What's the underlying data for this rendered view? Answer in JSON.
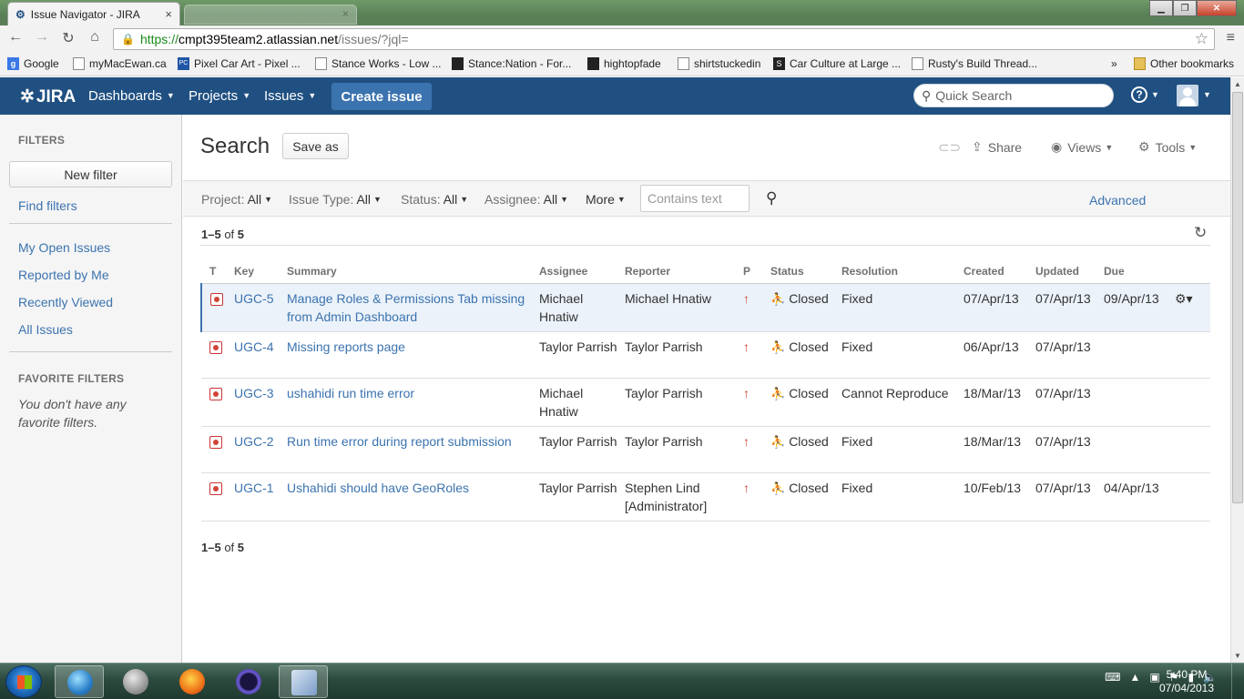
{
  "browser": {
    "tab_active_title": "Issue Navigator - JIRA",
    "tab_close": "×",
    "url_scheme": "https://",
    "url_host": "cmpt395team2.atlassian.net",
    "url_path": "/issues/?jql=",
    "bookmarks": [
      "Google",
      "myMacEwan.ca",
      "Pixel Car Art - Pixel ...",
      "Stance Works - Low ...",
      "Stance:Nation - For...",
      "hightopfade",
      "shirtstuckedin",
      "Car Culture at Large ...",
      "Rusty's Build Thread..."
    ],
    "bookmarks_overflow": "»",
    "other_bookmarks": "Other bookmarks"
  },
  "header": {
    "logo": "JIRA",
    "nav": [
      "Dashboards",
      "Projects",
      "Issues"
    ],
    "create_issue": "Create issue",
    "quick_search_placeholder": "Quick Search",
    "help": "?"
  },
  "sidebar": {
    "filters_heading": "FILTERS",
    "new_filter": "New filter",
    "find_filters": "Find filters",
    "links": [
      "My Open Issues",
      "Reported by Me",
      "Recently Viewed",
      "All Issues"
    ],
    "favorite_heading": "FAVORITE FILTERS",
    "no_favorites": "You don't have any favorite filters."
  },
  "main": {
    "title": "Search",
    "save_as": "Save as",
    "share": "Share",
    "views": "Views",
    "tools": "Tools",
    "criteria": [
      {
        "label": "Project:",
        "value": "All"
      },
      {
        "label": "Issue Type:",
        "value": "All"
      },
      {
        "label": "Status:",
        "value": "All"
      },
      {
        "label": "Assignee:",
        "value": "All"
      }
    ],
    "more": "More",
    "contains_text_placeholder": "Contains text",
    "advanced": "Advanced",
    "count_range": "1–5",
    "count_of": "of",
    "count_total": "5"
  },
  "table": {
    "headers": [
      "T",
      "Key",
      "Summary",
      "Assignee",
      "Reporter",
      "P",
      "Status",
      "Resolution",
      "Created",
      "Updated",
      "Due"
    ],
    "rows": [
      {
        "key": "UGC-5",
        "summary": "Manage Roles & Permissions Tab missing from Admin Dashboard",
        "assignee": "Michael Hnatiw",
        "reporter": "Michael Hnatiw",
        "status": "Closed",
        "resolution": "Fixed",
        "created": "07/Apr/13",
        "updated": "07/Apr/13",
        "due": "09/Apr/13"
      },
      {
        "key": "UGC-4",
        "summary": "Missing reports page",
        "assignee": "Taylor Parrish",
        "reporter": "Taylor Parrish",
        "status": "Closed",
        "resolution": "Fixed",
        "created": "06/Apr/13",
        "updated": "07/Apr/13",
        "due": ""
      },
      {
        "key": "UGC-3",
        "summary": "ushahidi run time error",
        "assignee": "Michael Hnatiw",
        "reporter": "Taylor Parrish",
        "status": "Closed",
        "resolution": "Cannot Reproduce",
        "created": "18/Mar/13",
        "updated": "07/Apr/13",
        "due": ""
      },
      {
        "key": "UGC-2",
        "summary": "Run time error during report submission",
        "assignee": "Taylor Parrish",
        "reporter": "Taylor Parrish",
        "status": "Closed",
        "resolution": "Fixed",
        "created": "18/Mar/13",
        "updated": "07/Apr/13",
        "due": ""
      },
      {
        "key": "UGC-1",
        "summary": "Ushahidi should have GeoRoles",
        "assignee": "Taylor Parrish",
        "reporter": "Stephen Lind [Administrator]",
        "status": "Closed",
        "resolution": "Fixed",
        "created": "10/Feb/13",
        "updated": "07/Apr/13",
        "due": "04/Apr/13"
      }
    ]
  },
  "taskbar": {
    "time": "5:40 PM",
    "date": "07/04/2013"
  },
  "colors": {
    "header_bg": "#205081",
    "link": "#3b73af",
    "priority": "#d04437"
  }
}
